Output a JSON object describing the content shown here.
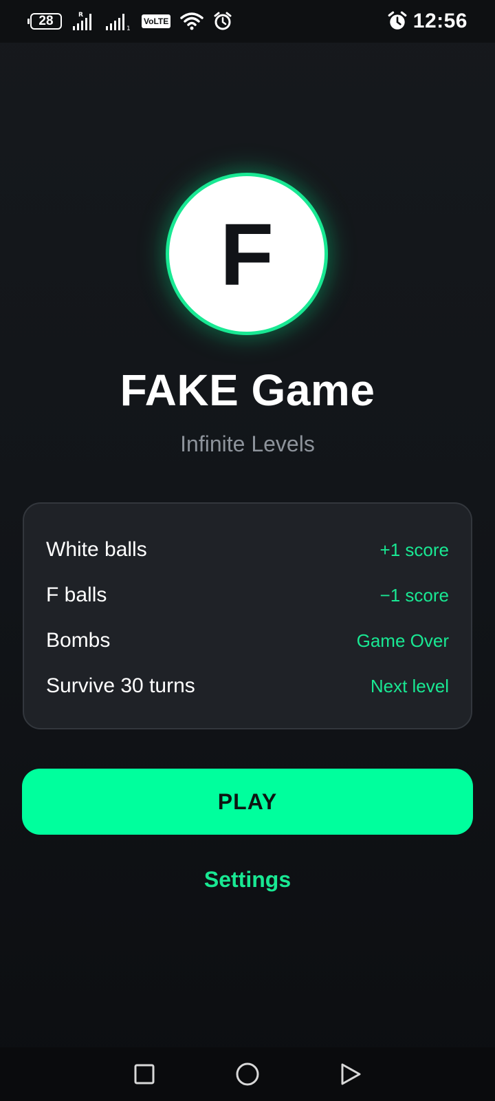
{
  "status_bar": {
    "battery_level": "28",
    "network_badge": "VoLTE",
    "roaming_mark": "R",
    "sim2_mark": "1",
    "time": "12:56",
    "icons": [
      "battery-icon",
      "signal-icon",
      "signal-icon",
      "volte-icon",
      "wifi-icon",
      "alarm-icon",
      "alarm-icon"
    ]
  },
  "app": {
    "logo_letter": "F",
    "title": "FAKE Game",
    "subtitle": "Infinite Levels",
    "accent_color": "#19e893",
    "button_color": "#00ff9d"
  },
  "rules": [
    {
      "label": "White balls",
      "value": "+1 score"
    },
    {
      "label": "F balls",
      "value": "−1 score"
    },
    {
      "label": "Bombs",
      "value": "Game Over"
    },
    {
      "label": "Survive 30 turns",
      "value": "Next level"
    }
  ],
  "actions": {
    "play_label": "PLAY",
    "settings_label": "Settings"
  },
  "nav": {
    "icons": [
      "recents-square-icon",
      "home-circle-icon",
      "back-triangle-icon"
    ]
  }
}
